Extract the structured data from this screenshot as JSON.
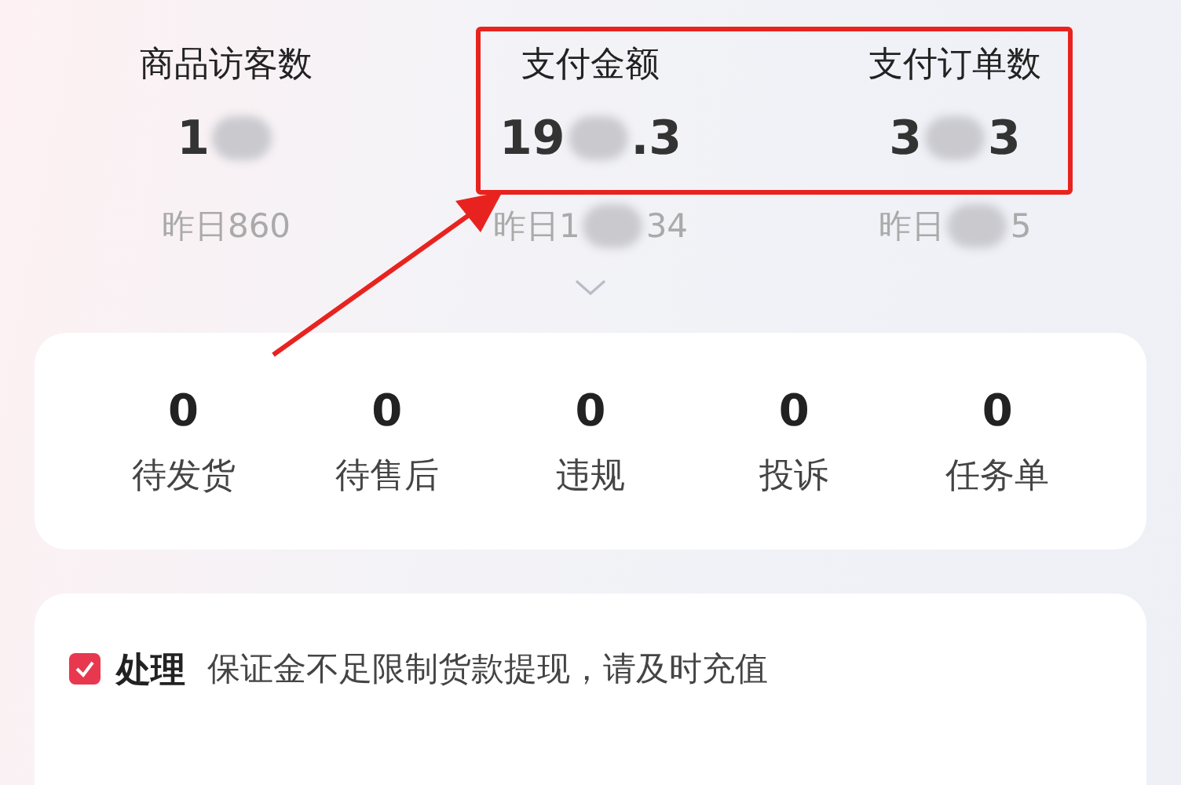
{
  "stats": [
    {
      "label": "商品访客数",
      "value": [
        "1"
      ],
      "yesterday": [
        "昨日860"
      ]
    },
    {
      "label": "支付金额",
      "value": [
        "19",
        ".3"
      ],
      "yesterday": [
        "昨日1",
        "34"
      ]
    },
    {
      "label": "支付订单数",
      "value": [
        "3",
        "3"
      ],
      "yesterday": [
        "昨日",
        "5"
      ]
    }
  ],
  "tasks": [
    {
      "count": "0",
      "label": "待发货"
    },
    {
      "count": "0",
      "label": "待售后"
    },
    {
      "count": "0",
      "label": "违规"
    },
    {
      "count": "0",
      "label": "投诉"
    },
    {
      "count": "0",
      "label": "任务单"
    }
  ],
  "notice": {
    "tag": "处理",
    "text": "保证金不足限制货款提现，请及时充值"
  }
}
